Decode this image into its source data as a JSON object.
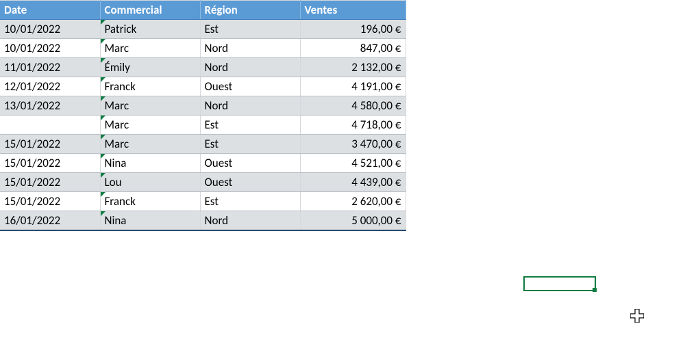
{
  "table": {
    "headers": {
      "date": "Date",
      "commercial": "Commercial",
      "region": "Région",
      "ventes": "Ventes"
    },
    "rows": [
      {
        "date": "10/01/2022",
        "commercial": "Patrick",
        "region": "Est",
        "ventes": "196,00 €",
        "band": "a",
        "tri": true
      },
      {
        "date": "10/01/2022",
        "commercial": "Marc",
        "region": "Nord",
        "ventes": "847,00 €",
        "band": "b",
        "tri": true
      },
      {
        "date": "11/01/2022",
        "commercial": "Émily",
        "region": "Nord",
        "ventes": "2 132,00 €",
        "band": "a",
        "tri": true
      },
      {
        "date": "12/01/2022",
        "commercial": "Franck",
        "region": "Ouest",
        "ventes": "4 191,00 €",
        "band": "b",
        "tri": true
      },
      {
        "date": "13/01/2022",
        "commercial": "Marc",
        "region": "Nord",
        "ventes": "4 580,00 €",
        "band": "a",
        "tri": true
      },
      {
        "date": "",
        "commercial": "Marc",
        "region": "Est",
        "ventes": "4 718,00 €",
        "band": "b",
        "tri": true
      },
      {
        "date": "15/01/2022",
        "commercial": "Marc",
        "region": "Est",
        "ventes": "3 470,00 €",
        "band": "a",
        "tri": true
      },
      {
        "date": "15/01/2022",
        "commercial": "Nina",
        "region": "Ouest",
        "ventes": "4 521,00 €",
        "band": "b",
        "tri": true
      },
      {
        "date": "15/01/2022",
        "commercial": "Lou",
        "region": "Ouest",
        "ventes": "4 439,00 €",
        "band": "a",
        "tri": true
      },
      {
        "date": "15/01/2022",
        "commercial": "Franck",
        "region": "Est",
        "ventes": "2 620,00 €",
        "band": "b",
        "tri": true
      },
      {
        "date": "16/01/2022",
        "commercial": "Nina",
        "region": "Nord",
        "ventes": "5 000,00 €",
        "band": "a",
        "tri": true
      }
    ]
  }
}
